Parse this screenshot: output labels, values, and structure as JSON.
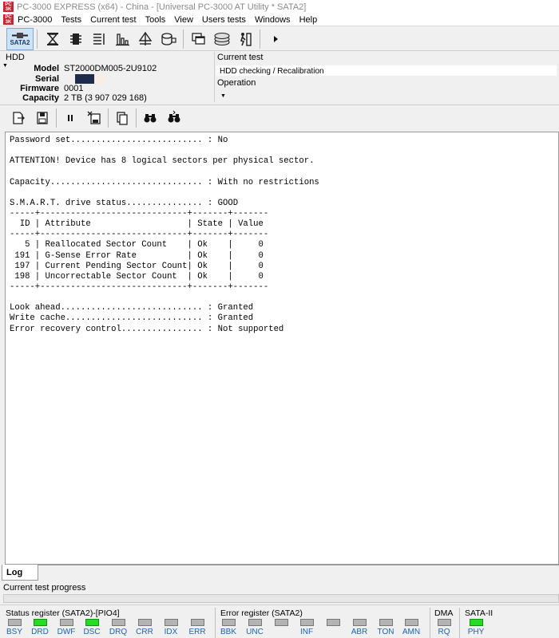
{
  "window": {
    "title": "PC-3000 EXPRESS (x64) - China - [Universal PC-3000 AT Utility * SATA2]"
  },
  "menu": {
    "items": [
      "PC-3000",
      "Tests",
      "Current test",
      "Tools",
      "View",
      "Users tests",
      "Windows",
      "Help"
    ]
  },
  "toolbar": {
    "sata_label": "SATA2"
  },
  "hdd": {
    "label": "HDD",
    "model_key": "Model",
    "model": "ST2000DM005-2U9102",
    "serial_key": "Serial",
    "serial": "",
    "firmware_key": "Firmware",
    "firmware": "0001",
    "capacity_key": "Capacity",
    "capacity": "2 TB (3 907 029 168)"
  },
  "current_test": {
    "label": "Current test",
    "value": "HDD checking / Recalibration",
    "operation_label": "Operation"
  },
  "log": {
    "lines": [
      "Password set.......................... : No",
      "",
      "ATTENTION! Device has 8 logical sectors per physical sector.",
      "",
      "Capacity.............................. : With no restrictions",
      "",
      "S.M.A.R.T. drive status............... : GOOD",
      "-----+-----------------------------+-------+-------",
      "  ID | Attribute                   | State | Value",
      "-----+-----------------------------+-------+-------",
      "   5 | Reallocated Sector Count    | Ok    |     0",
      " 191 | G-Sense Error Rate          | Ok    |     0",
      " 197 | Current Pending Sector Count| Ok    |     0",
      " 198 | Uncorrectable Sector Count  | Ok    |     0",
      "-----+-----------------------------+-------+-------",
      "",
      "Look ahead............................ : Granted",
      "Write cache........................... : Granted",
      "Error recovery control................ : Not supported"
    ]
  },
  "tabs": {
    "log": "Log"
  },
  "progress": {
    "label": "Current test progress",
    "value": 0
  },
  "status_register": {
    "title": "Status register (SATA2)-[PIO4]",
    "flags": [
      {
        "name": "BSY",
        "on": false
      },
      {
        "name": "DRD",
        "on": true
      },
      {
        "name": "DWF",
        "on": false
      },
      {
        "name": "DSC",
        "on": true
      },
      {
        "name": "DRQ",
        "on": false
      },
      {
        "name": "CRR",
        "on": false
      },
      {
        "name": "IDX",
        "on": false
      },
      {
        "name": "ERR",
        "on": false
      }
    ]
  },
  "error_register": {
    "title": "Error register (SATA2)",
    "flags": [
      {
        "name": "BBK",
        "on": false
      },
      {
        "name": "UNC",
        "on": false
      },
      {
        "name": "",
        "on": false
      },
      {
        "name": "INF",
        "on": false
      },
      {
        "name": "",
        "on": false
      },
      {
        "name": "ABR",
        "on": false
      },
      {
        "name": "TON",
        "on": false
      },
      {
        "name": "AMN",
        "on": false
      }
    ]
  },
  "dma": {
    "title": "DMA",
    "flags": [
      {
        "name": "RQ",
        "on": false
      }
    ]
  },
  "sata": {
    "title": "SATA-II",
    "flags": [
      {
        "name": "PHY",
        "on": true
      }
    ]
  },
  "colors": {
    "led_on": "#22dd22",
    "led_off": "#b4b4b4",
    "flag_text": "#1b63b6",
    "app_icon": "#c8262c"
  }
}
